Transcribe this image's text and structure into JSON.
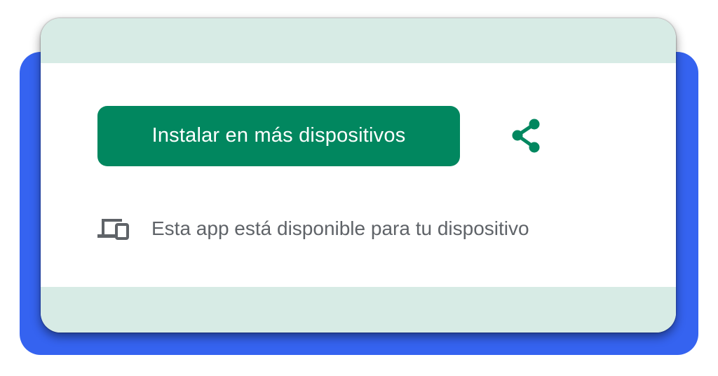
{
  "install": {
    "button_label": "Instalar en más dispositivos"
  },
  "share": {
    "icon": "share-icon"
  },
  "availability": {
    "icon": "devices-icon",
    "text": "Esta app está disponible para tu dispositivo"
  },
  "colors": {
    "accent_green": "#01875f",
    "band_mint": "#d7ebe5",
    "backdrop_blue": "#3563f0",
    "secondary_text": "#5f6368"
  }
}
